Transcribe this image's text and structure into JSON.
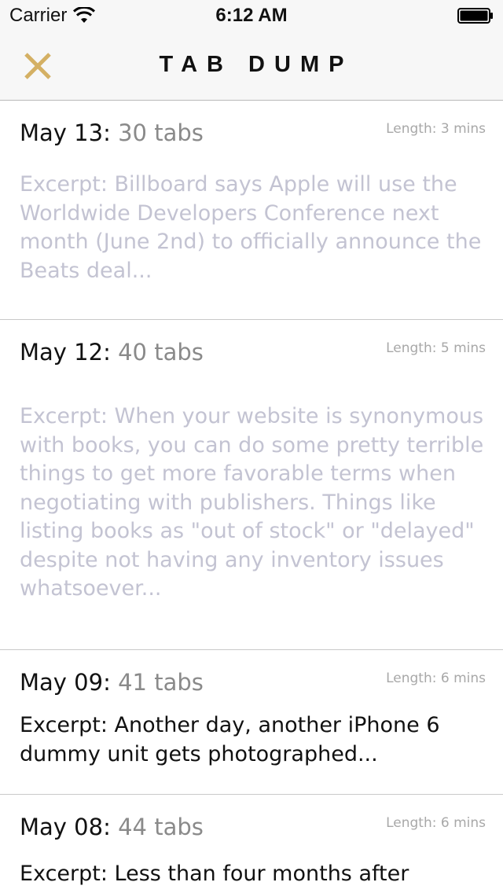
{
  "status_bar": {
    "carrier": "Carrier",
    "time": "6:12 AM",
    "icons": [
      "wifi-icon",
      "battery-icon"
    ]
  },
  "nav": {
    "title": "TAB DUMP",
    "close_icon": "close-icon",
    "accent_color": "#d4b064"
  },
  "entries": [
    {
      "date": "May 13",
      "tabs": "30 tabs",
      "length": "Length: 3 mins",
      "excerpt": "Excerpt: Billboard says Apple will use the Worldwide Developers Conference next month (June 2nd) to officially announce the Beats deal...",
      "read": true
    },
    {
      "date": "May 12",
      "tabs": "40 tabs",
      "length": "Length: 5 mins",
      "excerpt": "Excerpt: When your website is synonymous with books, you can do some pretty terrible things to get more favorable terms when negotiating with publishers. Things like listing books as \"out of stock\" or \"delayed\" despite not having any inventory issues whatsoever...",
      "read": true
    },
    {
      "date": "May 09",
      "tabs": "41 tabs",
      "length": "Length: 6 mins",
      "excerpt": "Excerpt: Another day, another iPhone 6 dummy unit gets photographed...",
      "read": false
    },
    {
      "date": "May 08",
      "tabs": "44 tabs",
      "length": "Length: 6 mins",
      "excerpt": "Excerpt: Less than four months after",
      "read": false
    }
  ]
}
